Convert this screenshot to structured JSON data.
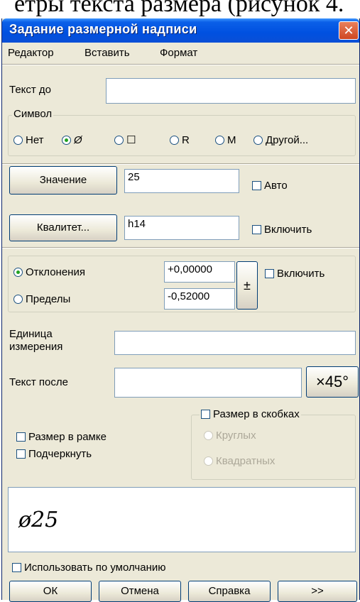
{
  "caption_fragment": "етры текста размера (рисунок 4.",
  "window": {
    "title": "Задание размерной надписи",
    "close_glyph": "✕"
  },
  "menu": [
    {
      "label": "Редактор"
    },
    {
      "label": "Вставить"
    },
    {
      "label": "Формат"
    }
  ],
  "text_before": {
    "label": "Текст до",
    "value": ""
  },
  "symbol_group": {
    "legend": "Символ",
    "options": [
      {
        "label": "Нет",
        "selected": false
      },
      {
        "label": "Ø",
        "selected": true
      },
      {
        "label": "☐",
        "selected": false
      },
      {
        "label": "R",
        "selected": false
      },
      {
        "label": "M",
        "selected": false
      },
      {
        "label": "Другой...",
        "selected": false
      }
    ]
  },
  "value": {
    "button": "Значение",
    "input": "25",
    "auto_label": "Авто",
    "auto_checked": false
  },
  "quality": {
    "button": "Квалитет...",
    "input": "h14",
    "include_label": "Включить",
    "include_checked": false
  },
  "tolerance": {
    "deviations_label": "Отклонения",
    "limits_label": "Пределы",
    "deviations_selected": true,
    "upper": "+0,00000",
    "lower": "-0,52000",
    "plusminus": "±",
    "include_label": "Включить",
    "include_checked": false
  },
  "unit": {
    "label": "Единица измерения",
    "value": ""
  },
  "text_after": {
    "label": "Текст после",
    "value": "",
    "button": "×45°"
  },
  "frame_checkbox": "Размер в рамке",
  "underline_checkbox": "Подчеркнуть",
  "brackets": {
    "label": "Размер в скобках",
    "round": "Круглых",
    "square": "Квадратных"
  },
  "preview_text": "ø25",
  "use_default": "Использовать по умолчанию",
  "buttons": {
    "ok": "ОК",
    "cancel": "Отмена",
    "help": "Справка",
    "more": ">>"
  }
}
